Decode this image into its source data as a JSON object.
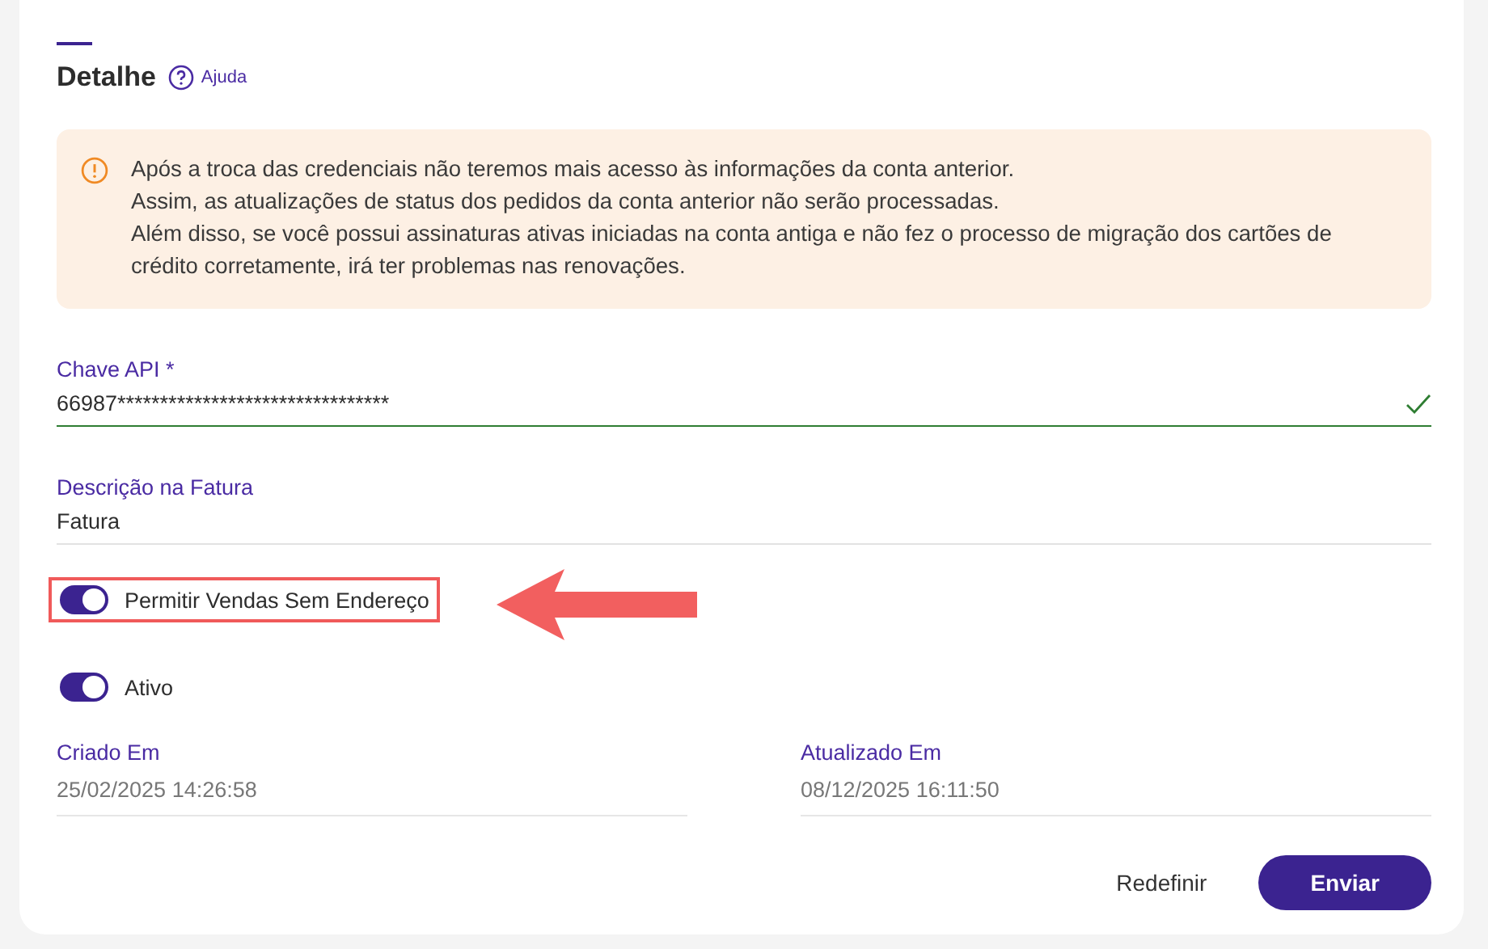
{
  "header": {
    "title": "Detalhe",
    "help_link": "Ajuda"
  },
  "warning": {
    "lines": [
      "Após a troca das credenciais não teremos mais acesso às informações da conta anterior.",
      "Assim, as atualizações de status dos pedidos da conta anterior não serão processadas.",
      "Além disso, se você possui assinaturas ativas iniciadas na conta antiga e não fez o processo de migração dos cartões de crédito corretamente, irá ter problemas nas renovações."
    ]
  },
  "fields": [
    {
      "label": "Chave API *",
      "value": "66987********************************",
      "valid": true
    },
    {
      "label": "Descrição na Fatura",
      "value": "Fatura",
      "valid": false
    }
  ],
  "toggles": [
    {
      "label": "Permitir Vendas Sem Endereço",
      "on": true,
      "highlighted": true
    },
    {
      "label": "Ativo",
      "on": true,
      "highlighted": false
    }
  ],
  "info": [
    {
      "label": "Criado Em",
      "value": "25/02/2025 14:26:58"
    },
    {
      "label": "Atualizado Em",
      "value": "08/12/2025 16:11:50"
    }
  ],
  "buttons": [
    {
      "label": "Redefinir",
      "kind": "text"
    },
    {
      "label": "Enviar",
      "kind": "primary"
    }
  ]
}
